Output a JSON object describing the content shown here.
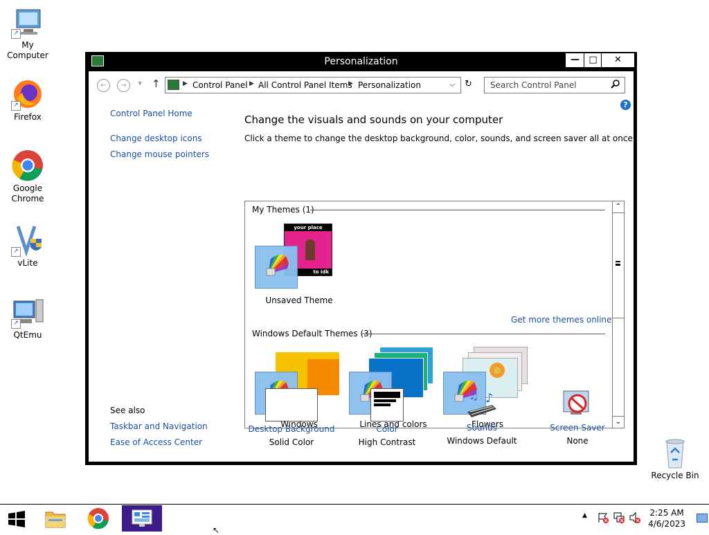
{
  "desktop": {
    "icons": [
      {
        "label": "My Computer"
      },
      {
        "label": "Firefox"
      },
      {
        "label": "Google Chrome"
      },
      {
        "label": "vLite"
      },
      {
        "label": "QtEmu"
      },
      {
        "label": "Recycle Bin"
      }
    ]
  },
  "window": {
    "title": "Personalization",
    "controls": {
      "minimize": "—",
      "maximize": "□",
      "close": "✕"
    }
  },
  "nav": {
    "breadcrumb": [
      "Control Panel",
      "All Control Panel Items",
      "Personalization"
    ],
    "search_placeholder": "Search Control Panel"
  },
  "left_pane": {
    "home_link": "Control Panel Home",
    "links": [
      "Change desktop icons",
      "Change mouse pointers"
    ],
    "see_also_heading": "See also",
    "see_also_links": [
      "Taskbar and Navigation",
      "Ease of Access Center"
    ]
  },
  "main": {
    "heading": "Change the visuals and sounds on your computer",
    "description": "Click a theme to change the desktop background, color, sounds, and screen saver all at once.",
    "my_themes": {
      "heading": "My Themes (1)",
      "themes": [
        {
          "name": "Unsaved Theme",
          "thumb_top_text": "your place",
          "thumb_bottom_text": "to idk"
        }
      ],
      "get_more_link": "Get more themes online"
    },
    "default_themes": {
      "heading": "Windows Default Themes (3)",
      "themes": [
        {
          "name": "Windows"
        },
        {
          "name": "Lines and colors"
        },
        {
          "name": "Flowers"
        }
      ]
    }
  },
  "bottom_settings": [
    {
      "title": "Desktop Background",
      "value": "Solid Color"
    },
    {
      "title": "Color",
      "value": "High Contrast"
    },
    {
      "title": "Sounds",
      "value": "Windows Default"
    },
    {
      "title": "Screen Saver",
      "value": "None"
    }
  ],
  "taskbar": {
    "time": "2:25 AM",
    "date": "4/6/2023"
  },
  "colors": {
    "link": "#1a4f9c",
    "titlebar": "#000000",
    "palette_tile": "#8cc0ef"
  }
}
